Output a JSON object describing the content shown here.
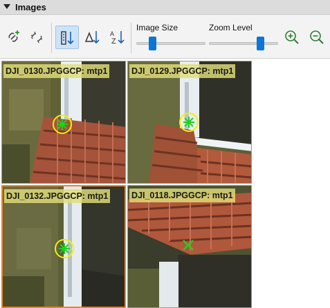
{
  "panel": {
    "title": "Images"
  },
  "toolbar": {
    "buttons": [
      {
        "name": "add-link",
        "icon": "link-add-icon"
      },
      {
        "name": "remove-link",
        "icon": "link-remove-icon"
      },
      {
        "name": "sort-by-name",
        "icon": "sort-order-icon",
        "active": true
      },
      {
        "name": "sort-by-triangle",
        "icon": "sort-delta-icon"
      },
      {
        "name": "sort-az",
        "icon": "sort-az-icon"
      },
      {
        "name": "zoom-in",
        "icon": "zoom-in-icon"
      },
      {
        "name": "zoom-out",
        "icon": "zoom-out-icon"
      }
    ],
    "image_size_label": "Image Size",
    "zoom_level_label": "Zoom Level",
    "image_size_value": 0.2,
    "zoom_level_value": 0.78,
    "accent": "#0a76d6"
  },
  "tiles": [
    {
      "label": "DJI_0130.JPGGCP: mtp1",
      "selected": false,
      "marker": "circle-star"
    },
    {
      "label": "DJI_0129.JPGGCP: mtp1",
      "selected": false,
      "marker": "circle-star"
    },
    {
      "label": "DJI_0132.JPGGCP: mtp1",
      "selected": true,
      "marker": "circle-star"
    },
    {
      "label": "DJI_0118.JPGGCP: mtp1",
      "selected": false,
      "marker": "cross"
    }
  ],
  "colors": {
    "selection": "#f0821e",
    "marker_circle": "#f4f000",
    "marker_star": "#1fd11f",
    "label_bg": "#e0de78"
  }
}
